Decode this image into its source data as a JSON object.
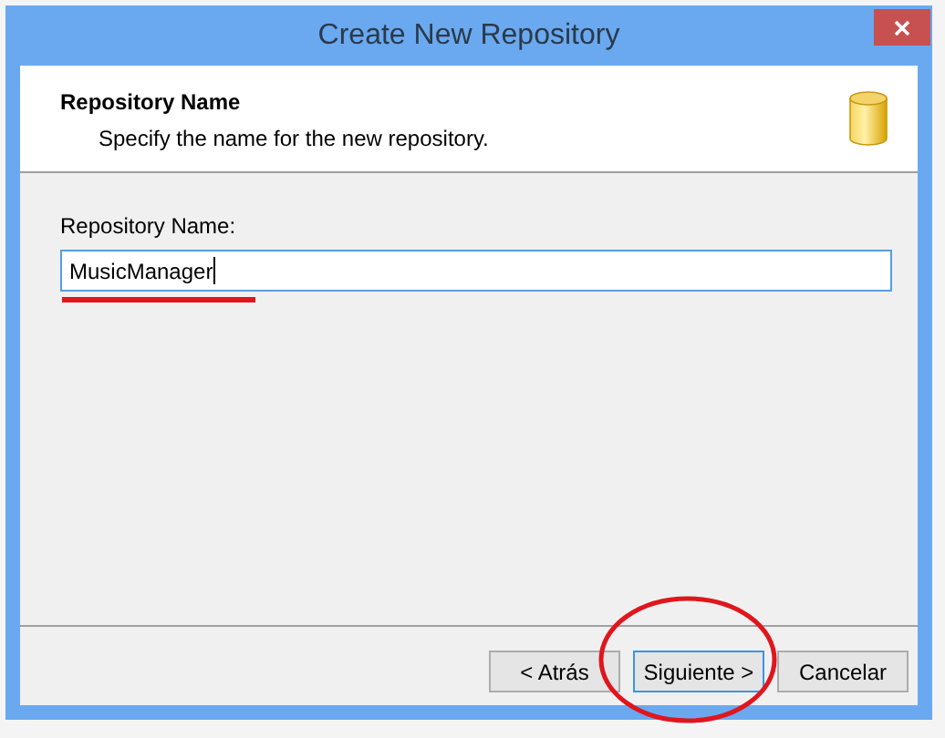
{
  "window": {
    "title": "Create New Repository"
  },
  "header": {
    "title": "Repository Name",
    "subtitle": "Specify the name for the new repository."
  },
  "field": {
    "label": "Repository Name:",
    "value": "MusicManager"
  },
  "buttons": [
    {
      "label": "< Atrás",
      "focused": false
    },
    {
      "label": "Siguiente >",
      "focused": true
    },
    {
      "label": "Cancelar",
      "focused": false
    }
  ]
}
